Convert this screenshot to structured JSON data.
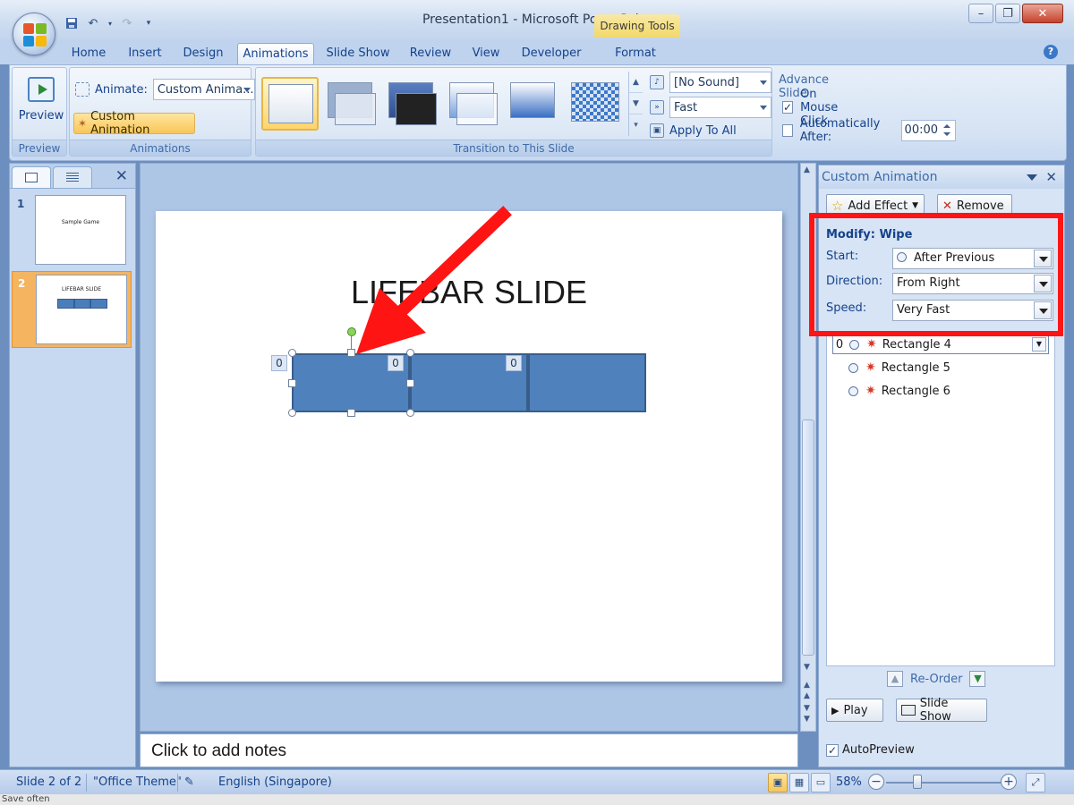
{
  "window": {
    "title": "Presentation1 - Microsoft PowerPoint",
    "contextual_tab_group": "Drawing Tools"
  },
  "tabs": [
    "Home",
    "Insert",
    "Design",
    "Animations",
    "Slide Show",
    "Review",
    "View",
    "Developer",
    "Format"
  ],
  "active_tab": "Animations",
  "ribbon": {
    "preview_group": {
      "button_label": "Preview",
      "group_label": "Preview"
    },
    "animations_group": {
      "animate_label": "Animate:",
      "animate_value": "Custom Anima...",
      "custom_animation_label": "Custom Animation",
      "group_label": "Animations"
    },
    "transition_group": {
      "sound_value": "[No Sound]",
      "speed_value": "Fast",
      "apply_all_label": "Apply To All",
      "group_label": "Transition to This Slide"
    },
    "advance_slide": {
      "title": "Advance Slide",
      "on_mouse_click_label": "On Mouse Click",
      "on_mouse_click_checked": true,
      "auto_after_label": "Automatically After:",
      "auto_after_checked": false,
      "auto_after_value": "00:00"
    }
  },
  "slides": [
    {
      "number": "1",
      "title": "Sample Game"
    },
    {
      "number": "2",
      "title": "LIFEBAR SLIDE"
    }
  ],
  "current_slide": {
    "title": "LIFEBAR SLIDE",
    "tags": [
      "0",
      "0",
      "0"
    ]
  },
  "notes_placeholder": "Click to add notes",
  "custom_animation": {
    "pane_title": "Custom Animation",
    "add_effect_label": "Add Effect",
    "remove_label": "Remove",
    "modify_title": "Modify: Wipe",
    "start_label": "Start:",
    "start_value": "After Previous",
    "direction_label": "Direction:",
    "direction_value": "From Right",
    "speed_label": "Speed:",
    "speed_value": "Very Fast",
    "items": [
      {
        "number": "0",
        "name": "Rectangle 4"
      },
      {
        "number": "",
        "name": "Rectangle 5"
      },
      {
        "number": "",
        "name": "Rectangle 6"
      }
    ],
    "reorder_label": "Re-Order",
    "play_label": "Play",
    "slide_show_label": "Slide Show",
    "autopreview_label": "AutoPreview",
    "autopreview_checked": true
  },
  "statusbar": {
    "slide_info": "Slide 2 of 2",
    "theme": "\"Office Theme\"",
    "language": "English (Singapore)",
    "zoom": "58%"
  },
  "below_status_text": "Save often",
  "colors": {
    "highlight_box": "#ff1414",
    "arrow": "#ff1414",
    "rectangle_fill": "#4f81bd"
  }
}
